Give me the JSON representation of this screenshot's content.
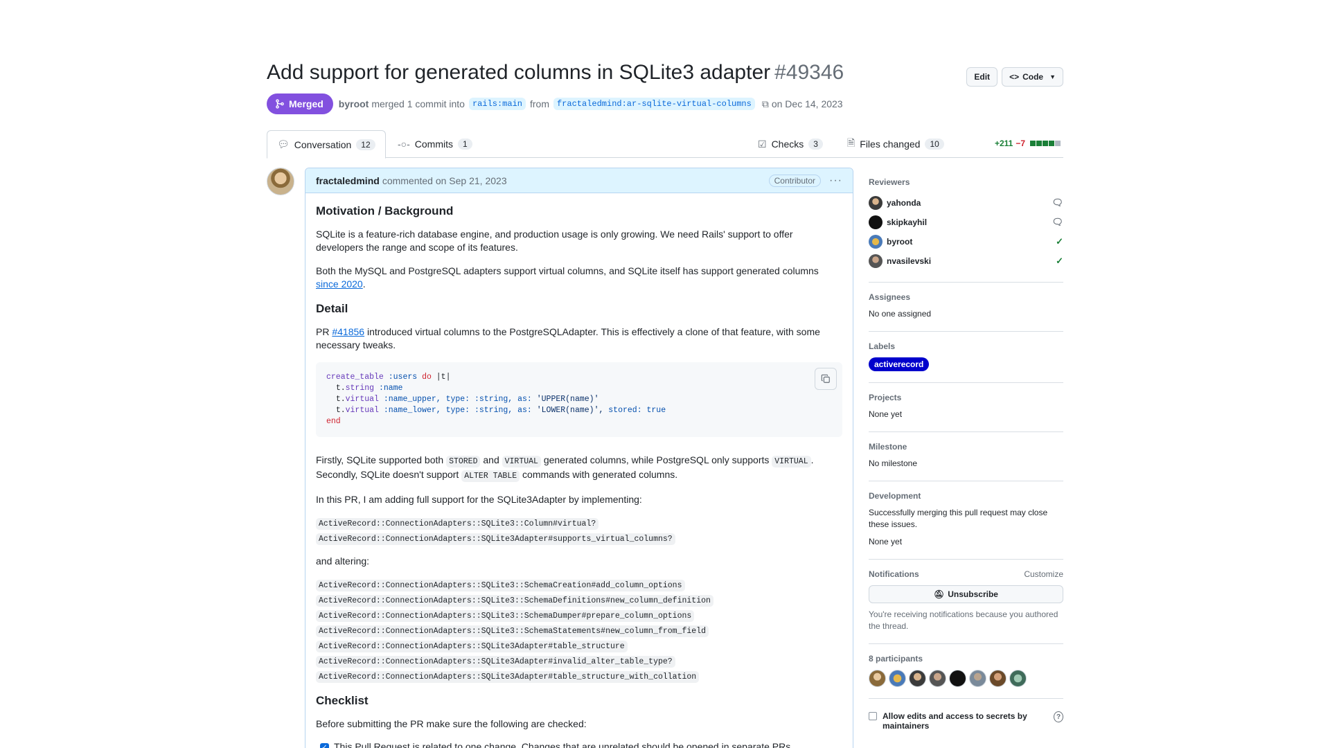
{
  "header": {
    "title": "Add support for generated columns in SQLite3 adapter",
    "number": "#49346",
    "edit_label": "Edit",
    "code_label": "Code"
  },
  "meta": {
    "state": "Merged",
    "author": "byroot",
    "merged_text": "merged 1 commit into",
    "base_branch": "rails:main",
    "from_text": "from",
    "head_branch": "fractaledmind:ar-sqlite-virtual-columns",
    "date_text": "on Dec 14, 2023"
  },
  "tabs": [
    {
      "label": "Conversation",
      "count": "12"
    },
    {
      "label": "Commits",
      "count": "1"
    },
    {
      "label": "Checks",
      "count": "3"
    },
    {
      "label": "Files changed",
      "count": "10"
    }
  ],
  "diffstat": {
    "additions": "+211",
    "deletions": "−7",
    "colors": [
      "#1a7f37",
      "#1a7f37",
      "#1a7f37",
      "#1a7f37",
      "#afb8c1"
    ]
  },
  "comment": {
    "author": "fractaledmind",
    "commented": "commented on Sep 21, 2023",
    "role": "Contributor",
    "h_motivation": "Motivation / Background",
    "p1": "SQLite is a feature-rich database engine, and production usage is only growing. We need Rails' support to offer developers the range and scope of its features.",
    "p2a": "Both the MySQL and PostgreSQL adapters support virtual columns, and SQLite itself has support generated columns",
    "p2_link": "since 2020",
    "p2b": ".",
    "h_detail": "Detail",
    "p3a": "PR",
    "p3_link": "#41856",
    "p3b": "introduced virtual columns to the PostgreSQLAdapter. This is effectively a clone of that feature, with some necessary tweaks.",
    "p4a": "Firstly, SQLite supported both",
    "p4_c1": "STORED",
    "p4b": "and",
    "p4_c2": "VIRTUAL",
    "p4c": "generated columns, while PostgreSQL only supports",
    "p4_c3": "VIRTUAL",
    "p4d": ".",
    "p4e": "Secondly, SQLite doesn't support",
    "p4_c4": "ALTER TABLE",
    "p4f": "commands with generated columns.",
    "p5": "In this PR, I am adding full support for the SQLite3Adapter by implementing:",
    "impl": [
      "ActiveRecord::ConnectionAdapters::SQLite3::Column#virtual?",
      "ActiveRecord::ConnectionAdapters::SQLite3Adapter#supports_virtual_columns?"
    ],
    "p6": "and altering:",
    "alter": [
      "ActiveRecord::ConnectionAdapters::SQLite3::SchemaCreation#add_column_options",
      "ActiveRecord::ConnectionAdapters::SQLite3::SchemaDefinitions#new_column_definition",
      "ActiveRecord::ConnectionAdapters::SQLite3::SchemaDumper#prepare_column_options",
      "ActiveRecord::ConnectionAdapters::SQLite3::SchemaStatements#new_column_from_field",
      "ActiveRecord::ConnectionAdapters::SQLite3Adapter#table_structure",
      "ActiveRecord::ConnectionAdapters::SQLite3Adapter#invalid_alter_table_type?",
      "ActiveRecord::ConnectionAdapters::SQLite3Adapter#table_structure_with_collation"
    ],
    "h_checklist": "Checklist",
    "p7": "Before submitting the PR make sure the following are checked:",
    "check1": "This Pull Request is related to one change. Changes that are unrelated should be opened in separate PRs."
  },
  "code": {
    "l1_fn": "create_table",
    "l1_sym": ":users",
    "l1_kw": "do",
    "l1_rest": "|t|",
    "l2_a": "t.",
    "l2_fn": "string",
    "l2_sym": ":name",
    "l3_a": "t.",
    "l3_fn": "virtual",
    "l3_sym": ":name_upper,",
    "l3_b": "type:",
    "l3_sym2": ":string,",
    "l3_c": "as:",
    "l3_str": "'UPPER(name)'",
    "l4_a": "t.",
    "l4_fn": "virtual",
    "l4_sym": ":name_lower,",
    "l4_b": "type:",
    "l4_sym2": ":string,",
    "l4_c": "as:",
    "l4_str": "'LOWER(name)',",
    "l4_d": "stored:",
    "l4_kw": "true",
    "l5_kw": "end"
  },
  "sidebar": {
    "reviewers_title": "Reviewers",
    "reviewers": [
      {
        "name": "yahonda",
        "status": "comment-icon"
      },
      {
        "name": "skipkayhil",
        "status": "comment-icon"
      },
      {
        "name": "byroot",
        "status": "check-icon"
      },
      {
        "name": "nvasilevski",
        "status": "check-icon"
      }
    ],
    "assignees_title": "Assignees",
    "assignees": "No one assigned",
    "labels_title": "Labels",
    "label": "activerecord",
    "projects_title": "Projects",
    "projects": "None yet",
    "milestone_title": "Milestone",
    "milestone": "No milestone",
    "development_title": "Development",
    "development_text": "Successfully merging this pull request may close these issues.",
    "development_none": "None yet",
    "notifications_title": "Notifications",
    "customize": "Customize",
    "unsubscribe": "Unsubscribe",
    "notif_reason": "You're receiving notifications because you authored the thread.",
    "participants_title": "8 participants",
    "allow_text": "Allow edits and access to secrets by maintainers"
  }
}
